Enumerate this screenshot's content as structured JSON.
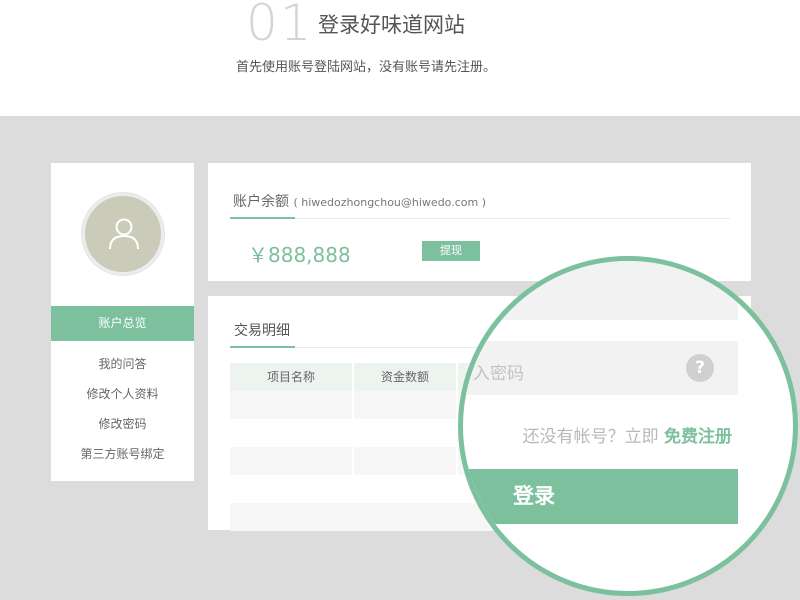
{
  "header": {
    "step_number": "01",
    "step_title": "登录好味道网站",
    "step_desc": "首先使用账号登陆网站，没有账号请先注册。"
  },
  "sidebar": {
    "avatar_icon": "user-icon",
    "active_item": "账户总览",
    "items": [
      "我的问答",
      "修改个人资料",
      "修改密码",
      "第三方账号绑定"
    ]
  },
  "balance": {
    "title": "账户余额",
    "email": "( hiwedozhongchou@hiwedo.com )",
    "amount": "￥888,888",
    "withdraw_label": "提现"
  },
  "transactions": {
    "title": "交易明细",
    "columns": [
      "项目名称",
      "资金数额"
    ]
  },
  "magnifier": {
    "password_placeholder": "入密码",
    "help_icon": "question-icon",
    "help_text": "?",
    "register_prompt": "还没有帐号？立即",
    "register_link": "免费注册",
    "login_label": "登录"
  },
  "colors": {
    "accent": "#7cc09e",
    "background_grey": "#dcdcdc",
    "avatar_bg": "#cbcbb9"
  }
}
